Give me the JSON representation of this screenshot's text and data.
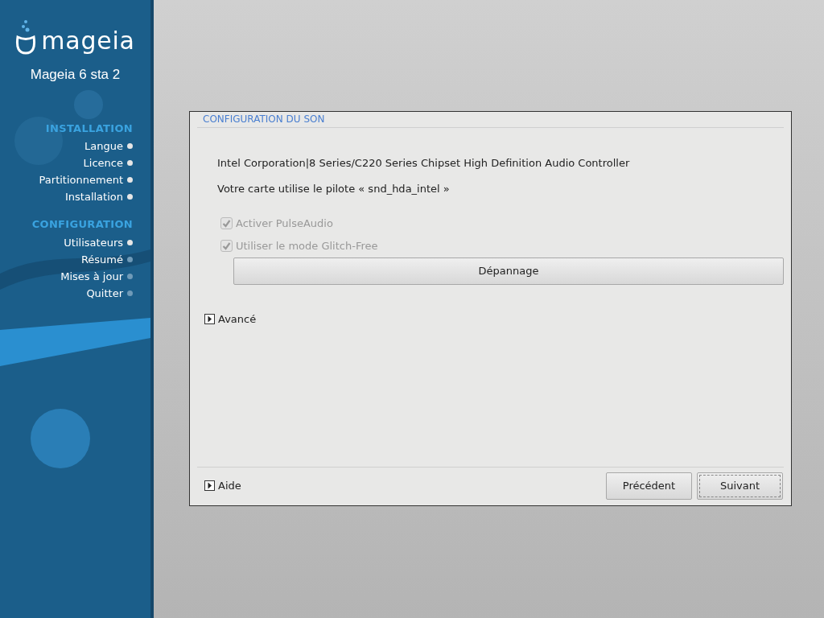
{
  "sidebar": {
    "logo_text": "mageia",
    "version": "Mageia 6 sta 2",
    "sections": [
      {
        "title": "INSTALLATION",
        "steps": [
          {
            "label": "Langue",
            "done": true
          },
          {
            "label": "Licence",
            "done": true
          },
          {
            "label": "Partitionnement",
            "done": true
          },
          {
            "label": "Installation",
            "done": true
          }
        ]
      },
      {
        "title": "CONFIGURATION",
        "steps": [
          {
            "label": "Utilisateurs",
            "done": true
          },
          {
            "label": "Résumé",
            "done": false
          },
          {
            "label": "Mises à jour",
            "done": false
          },
          {
            "label": "Quitter",
            "done": false
          }
        ]
      }
    ]
  },
  "dialog": {
    "title": "CONFIGURATION DU SON",
    "device": "Intel Corporation|8 Series/C220 Series Chipset High Definition Audio Controller",
    "driver_note": "Votre carte utilise le pilote « snd_hda_intel »",
    "options": [
      {
        "label": "Activer PulseAudio",
        "checked": true,
        "disabled": true
      },
      {
        "label": "Utiliser le mode Glitch-Free",
        "checked": true,
        "disabled": true
      }
    ],
    "troubleshoot_button": "Dépannage",
    "advanced": {
      "label": "Avancé",
      "expanded": false
    },
    "help": {
      "label": "Aide",
      "expanded": false
    },
    "buttons": [
      {
        "label": "Précédent",
        "focused": false
      },
      {
        "label": "Suivant",
        "focused": true
      }
    ]
  }
}
